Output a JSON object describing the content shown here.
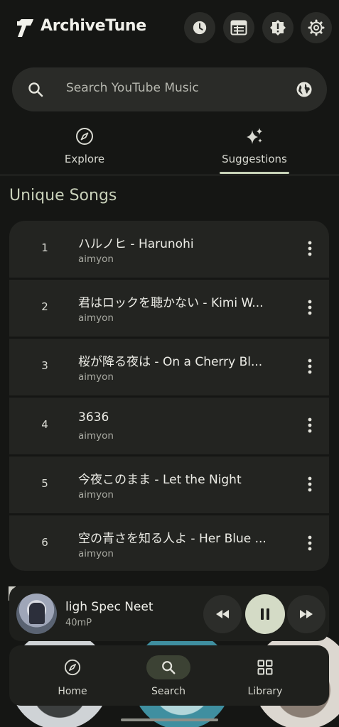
{
  "app": {
    "title": "ArchiveTune",
    "logo_icon": "archivetune-logo-icon"
  },
  "header_actions": [
    {
      "icon": "history-icon"
    },
    {
      "icon": "stats-icon"
    },
    {
      "icon": "alert-badge-icon"
    },
    {
      "icon": "gear-icon"
    }
  ],
  "search": {
    "placeholder": "Search YouTube Music",
    "left_icon": "search-icon",
    "right_icon": "globe-icon"
  },
  "tabs": [
    {
      "label": "Explore",
      "icon": "compass-icon",
      "selected": false
    },
    {
      "label": "Suggestions",
      "icon": "sparkle-icon",
      "selected": true
    }
  ],
  "section": {
    "title": "Unique Songs"
  },
  "songs": [
    {
      "rank": "1",
      "title": "ハルノヒ - Harunohi",
      "artist": "aimyon"
    },
    {
      "rank": "2",
      "title": "君はロックを聴かない - Kimi W...",
      "artist": "aimyon"
    },
    {
      "rank": "3",
      "title": "桜が降る夜は - On a Cherry Bl...",
      "artist": "aimyon"
    },
    {
      "rank": "4",
      "title": "3636",
      "artist": "aimyon"
    },
    {
      "rank": "5",
      "title": "今夜このまま - Let the Night",
      "artist": "aimyon"
    },
    {
      "rank": "6",
      "title": "空の青さを知る人よ - Her Blue ...",
      "artist": "aimyon"
    }
  ],
  "mini_player": {
    "title": "ligh Spec Neet",
    "subtitle": "40mP",
    "state": "playing"
  },
  "bottom_nav": [
    {
      "label": "Home",
      "icon": "compass-icon",
      "active": false
    },
    {
      "label": "Search",
      "icon": "search-icon",
      "active": true
    },
    {
      "label": "Library",
      "icon": "library-icon",
      "active": false
    }
  ],
  "colors": {
    "background": "#151614",
    "surface": "#232421",
    "accent": "#c7d2b7",
    "play_button": "#d4dbc6"
  }
}
